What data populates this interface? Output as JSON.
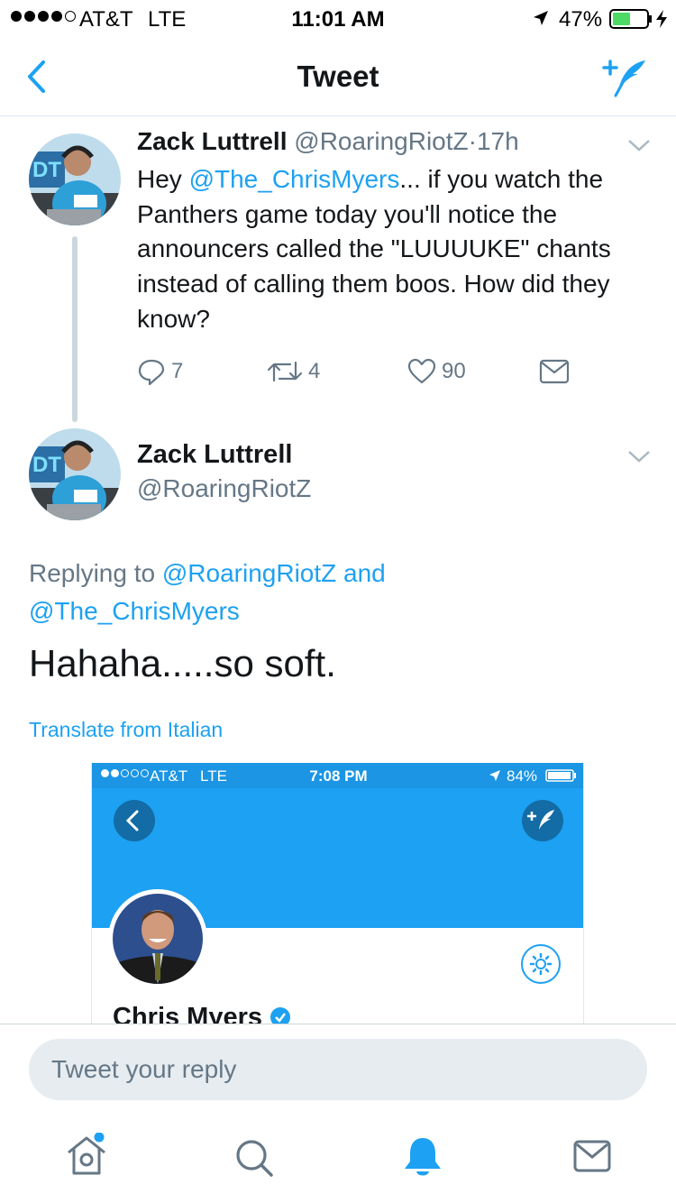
{
  "status_bar": {
    "carrier": "AT&T",
    "network": "LTE",
    "time": "11:01 AM",
    "battery": "47%"
  },
  "nav": {
    "title": "Tweet"
  },
  "tweet1": {
    "name": "Zack Luttrell",
    "handle": "@RoaringRiotZ",
    "separator": "·",
    "time": "17h",
    "text_prefix": "Hey ",
    "mention": "@The_ChrisMyers",
    "text_rest": "... if you watch the Panthers game today you'll notice the announcers called the \"LUUUUKE\" chants instead of calling them boos. How did they know?",
    "replies": "7",
    "retweets": "4",
    "likes": "90"
  },
  "tweet2": {
    "name": "Zack Luttrell",
    "handle": "@RoaringRiotZ",
    "replying_prefix": "Replying to ",
    "reply_mention1": "@RoaringRiotZ",
    "reply_and": " and",
    "reply_mention2": "@The_ChrisMyers",
    "text": "Hahaha.....so soft.",
    "translate": "Translate from Italian"
  },
  "embedded": {
    "carrier": "AT&T",
    "network": "LTE",
    "time": "7:08 PM",
    "battery": "84%",
    "profile_name": "Chris Myers",
    "header_color": "#1da1f2"
  },
  "reply": {
    "placeholder": "Tweet your reply"
  },
  "tabbar": {
    "icons": [
      "home-icon",
      "search-icon",
      "notifications-icon",
      "messages-icon"
    ]
  },
  "colors": {
    "accent": "#1da1f2",
    "text": "#14171a",
    "secondary": "#657786"
  }
}
